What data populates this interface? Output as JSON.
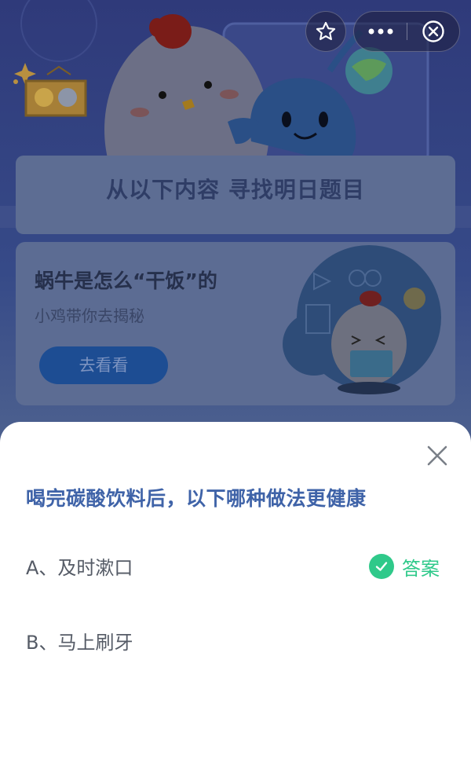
{
  "background": {
    "title": "从以下内容 寻找明日题目",
    "promo": {
      "title": "蜗牛是怎么“干饭”的",
      "subtitle": "小鸡带你去揭秘",
      "button_label": "去看看"
    }
  },
  "capsule": {
    "favorite_icon": "star-icon",
    "more_icon": "more-dots-icon",
    "exit_icon": "close-circle-icon"
  },
  "sheet": {
    "close_icon": "close-icon",
    "question": "喝完碳酸饮料后，以下哪种做法更健康",
    "options": [
      {
        "label": "A、及时漱口",
        "is_answer": true
      },
      {
        "label": "B、马上刷牙",
        "is_answer": false
      }
    ],
    "answer_label": "答案"
  },
  "colors": {
    "question": "#3f63a8",
    "answer_green": "#2fc98a",
    "option_text": "#555b66",
    "sheet_background": "#ffffff"
  }
}
